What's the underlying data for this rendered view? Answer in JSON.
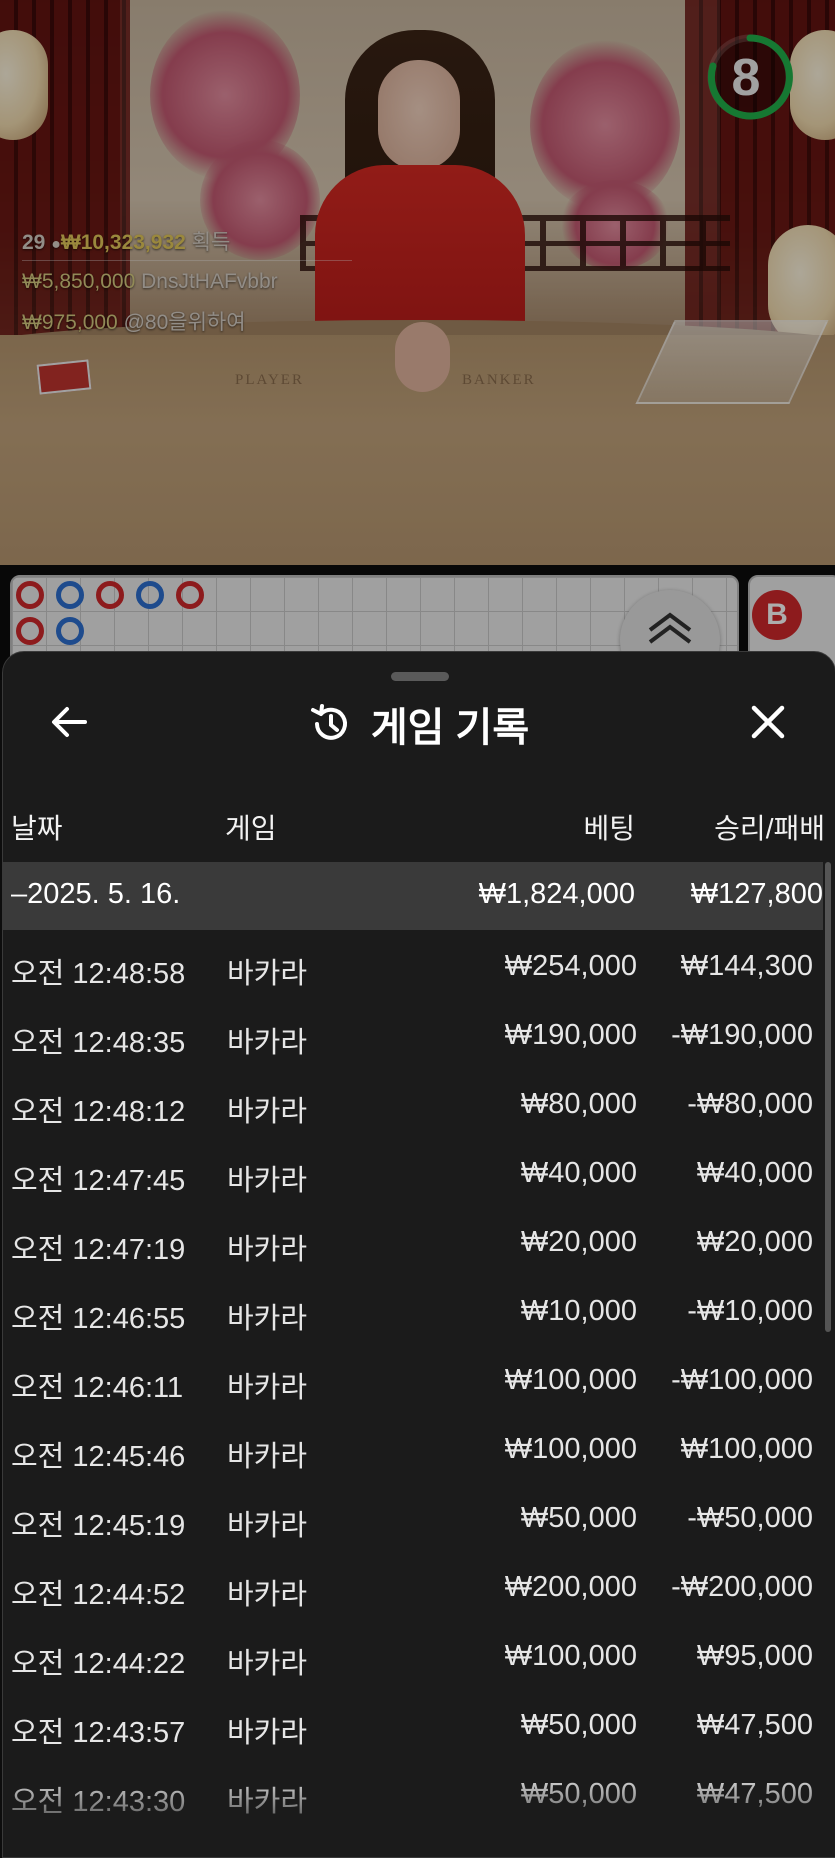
{
  "video": {
    "timer": "8",
    "table_labels": {
      "player": "PLAYER",
      "banker": "BANKER"
    },
    "win_feed": {
      "count": "29",
      "total": "₩10,323,932",
      "total_suffix": "획득",
      "wins": [
        {
          "amount": "₩5,850,000",
          "user": "DnsJtHAFvbbr"
        },
        {
          "amount": "₩975,000",
          "user": "@80을위하여"
        }
      ]
    },
    "side_badge": "B"
  },
  "road": {
    "beads": [
      "r",
      "b",
      "r",
      "b",
      "r",
      "r",
      "b"
    ]
  },
  "panel": {
    "title": "게임 기록",
    "columns": {
      "date": "날짜",
      "game": "게임",
      "bet": "베팅",
      "result": "승리/패배"
    },
    "summary": {
      "date": "–2025. 5. 16.",
      "bet": "₩1,824,000",
      "result": "₩127,800"
    },
    "rows": [
      {
        "time": "오전 12:48:58",
        "game": "바카라",
        "bet": "₩254,000",
        "result": "₩144,300"
      },
      {
        "time": "오전 12:48:35",
        "game": "바카라",
        "bet": "₩190,000",
        "result": "-₩190,000"
      },
      {
        "time": "오전 12:48:12",
        "game": "바카라",
        "bet": "₩80,000",
        "result": "-₩80,000"
      },
      {
        "time": "오전 12:47:45",
        "game": "바카라",
        "bet": "₩40,000",
        "result": "₩40,000"
      },
      {
        "time": "오전 12:47:19",
        "game": "바카라",
        "bet": "₩20,000",
        "result": "₩20,000"
      },
      {
        "time": "오전 12:46:55",
        "game": "바카라",
        "bet": "₩10,000",
        "result": "-₩10,000"
      },
      {
        "time": "오전 12:46:11",
        "game": "바카라",
        "bet": "₩100,000",
        "result": "-₩100,000"
      },
      {
        "time": "오전 12:45:46",
        "game": "바카라",
        "bet": "₩100,000",
        "result": "₩100,000"
      },
      {
        "time": "오전 12:45:19",
        "game": "바카라",
        "bet": "₩50,000",
        "result": "-₩50,000"
      },
      {
        "time": "오전 12:44:52",
        "game": "바카라",
        "bet": "₩200,000",
        "result": "-₩200,000"
      },
      {
        "time": "오전 12:44:22",
        "game": "바카라",
        "bet": "₩100,000",
        "result": "₩95,000"
      },
      {
        "time": "오전 12:43:57",
        "game": "바카라",
        "bet": "₩50,000",
        "result": "₩47,500"
      },
      {
        "time": "오전 12:43:30",
        "game": "바카라",
        "bet": "₩50,000",
        "result": "₩47,500"
      }
    ]
  }
}
